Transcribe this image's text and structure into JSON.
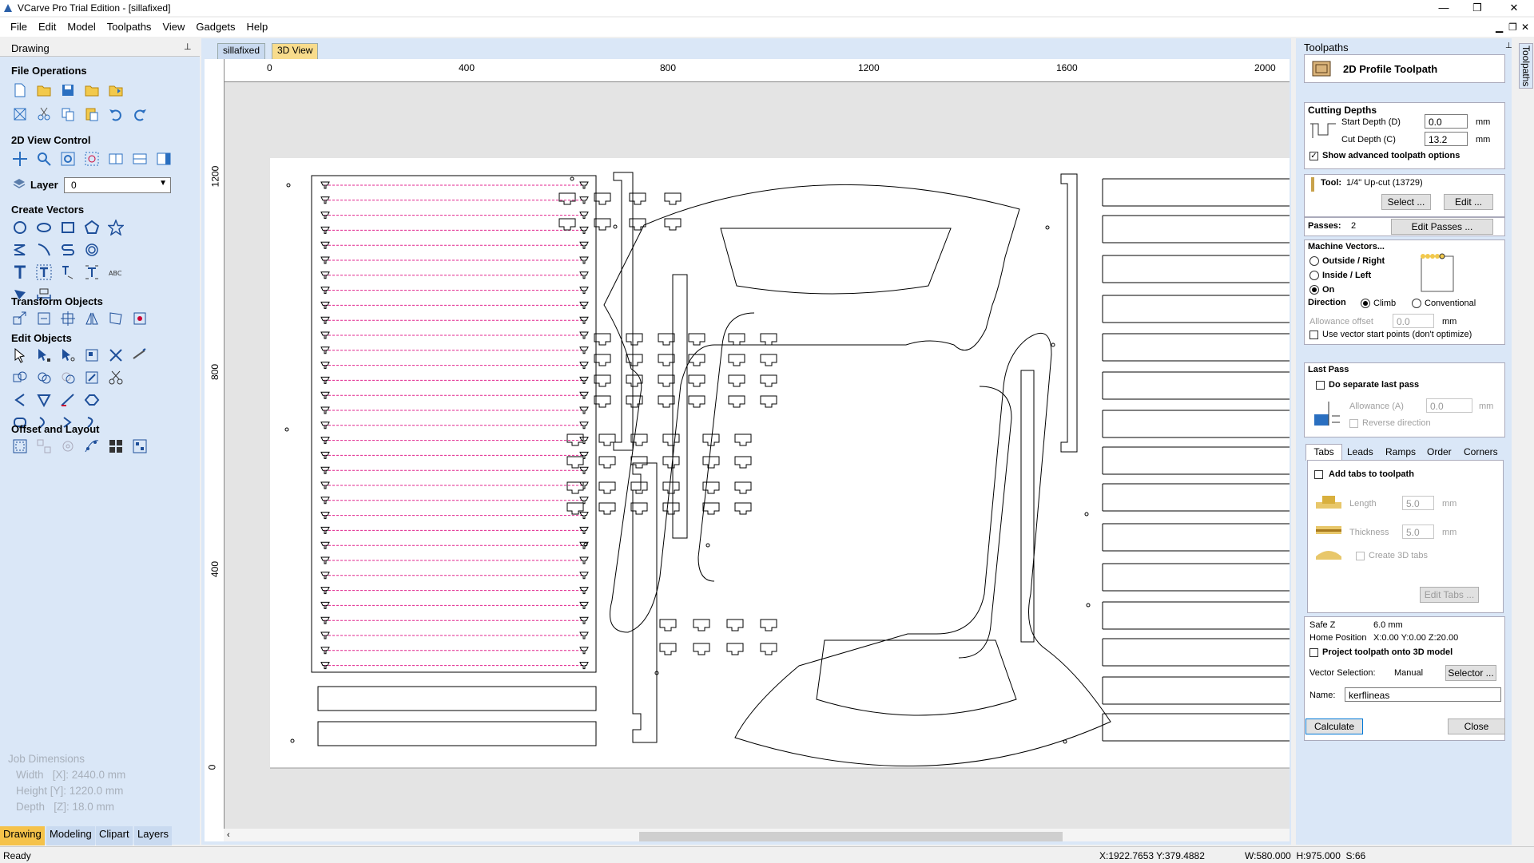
{
  "window": {
    "title": "VCarve Pro Trial Edition - [sillafixed]",
    "minimize": "—",
    "restore": "❐",
    "close": "✕"
  },
  "menu": [
    "File",
    "Edit",
    "Model",
    "Toolpaths",
    "View",
    "Gadgets",
    "Help"
  ],
  "left_panel": {
    "title": "Drawing",
    "sections": {
      "file_ops": "File Operations",
      "view_ctrl": "2D View Control",
      "layer_label": "Layer",
      "layer_value": "0",
      "create_vectors": "Create Vectors",
      "transform": "Transform Objects",
      "edit": "Edit Objects",
      "offset": "Offset and Layout"
    },
    "job_dimensions": {
      "title": "Job Dimensions",
      "width": "Width   [X]: 2440.0 mm",
      "height": "Height [Y]: 1220.0 mm",
      "depth": "Depth   [Z]: 18.0 mm"
    },
    "tabs": [
      "Drawing",
      "Modeling",
      "Clipart",
      "Layers"
    ]
  },
  "doc_tabs": [
    "sillafixed",
    "3D View"
  ],
  "rulers": {
    "h": [
      "0",
      "400",
      "800",
      "1200",
      "1600",
      "2000"
    ],
    "v": [
      "1200",
      "800",
      "400",
      "0"
    ]
  },
  "right_panel": {
    "title": "Toolpaths",
    "vertical_tab": "Toolpaths",
    "toolpath_name": "2D Profile Toolpath",
    "cutting_depths": {
      "title": "Cutting Depths",
      "start_label": "Start Depth (D)",
      "start_value": "0.0",
      "cut_label": "Cut Depth (C)",
      "cut_value": "13.2",
      "unit": "mm",
      "show_advanced": "Show advanced toolpath options"
    },
    "tool": {
      "label": "Tool:",
      "value": "1/4\" Up-cut (13729)",
      "select": "Select ...",
      "edit": "Edit ..."
    },
    "passes": {
      "label": "Passes:",
      "value": "2",
      "button": "Edit Passes ..."
    },
    "machine_vectors": {
      "title": "Machine Vectors...",
      "outside": "Outside / Right",
      "inside": "Inside / Left",
      "on": "On",
      "direction": "Direction",
      "climb": "Climb",
      "conventional": "Conventional",
      "allowance_label": "Allowance offset",
      "allowance_value": "0.0",
      "unit": "mm",
      "use_start": "Use vector start points (don't optimize)"
    },
    "last_pass": {
      "title": "Last Pass",
      "separate": "Do separate last pass",
      "allowance_label": "Allowance (A)",
      "allowance_value": "0.0",
      "unit": "mm",
      "reverse": "Reverse direction"
    },
    "tabs": [
      "Tabs",
      "Leads",
      "Ramps",
      "Order",
      "Corners"
    ],
    "tabs_panel": {
      "add_tabs": "Add tabs to toolpath",
      "length_label": "Length",
      "length_value": "5.0",
      "thickness_label": "Thickness",
      "thickness_value": "5.0",
      "unit": "mm",
      "create3d": "Create 3D tabs",
      "edit_tabs": "Edit Tabs ..."
    },
    "safe_z_label": "Safe Z",
    "safe_z_value": "6.0 mm",
    "home_label": "Home Position",
    "home_value": "X:0.00 Y:0.00 Z:20.00",
    "project": "Project toolpath onto 3D model",
    "vector_selection_label": "Vector Selection:",
    "vector_selection_value": "Manual",
    "selector": "Selector ...",
    "name_label": "Name:",
    "name_value": "kerflineas",
    "calculate": "Calculate",
    "close": "Close"
  },
  "status": {
    "ready": "Ready",
    "coords": "X:1922.7653 Y:379.4882",
    "size": "W:580.000  H:975.000  S:66"
  }
}
